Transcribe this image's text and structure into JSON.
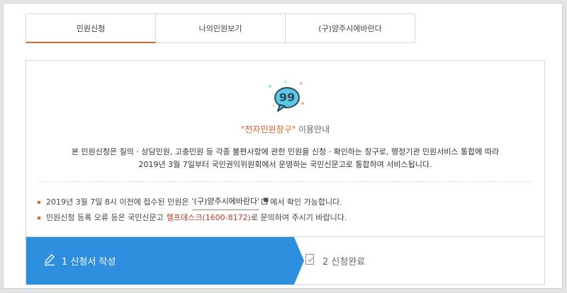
{
  "tabs": [
    {
      "label": "민원신청",
      "active": true
    },
    {
      "label": "나의민원보기",
      "active": false
    },
    {
      "label": "(구)양주시에바란다",
      "active": false
    }
  ],
  "notice": {
    "icon": "quote-speech-bubble-icon",
    "title_highlight": "\"전자민원창구\"",
    "title_rest": " 이용안내",
    "desc_line1": "본 민원신청은 질의 · 상담민원, 고충민원 등 각종 불편사항에 관한 민원을 신청 · 확인하는 창구로, 행정기관 민원서비스 통합에 따라",
    "desc_line2": "2019년 3월 7일부터 국민권익위원회에서 운영하는 국민신문고로 통합하여 서비스됩니다."
  },
  "bullets": {
    "b1_pre": "2019년 3월 7일 8시 이전에 접수된 민원은",
    "b1_link": "'(구)양주시에바란다'",
    "b1_post": "에서 확인 가능합니다.",
    "b2_pre": "민원신청 등록 오류 등은 국민신문고",
    "b2_link": "헬프데스크(1600-8172)",
    "b2_post": "로 문의하여 주시기 바랍니다."
  },
  "steps": [
    {
      "label": "1  신청서 작성",
      "active": true,
      "icon": "pencil-icon"
    },
    {
      "label": "2  신청완료",
      "active": false,
      "icon": "document-check-icon"
    }
  ],
  "colors": {
    "accent": "#e0632a",
    "step_active": "#2e8fe0",
    "icon_bubble": "#5bc8e8"
  }
}
